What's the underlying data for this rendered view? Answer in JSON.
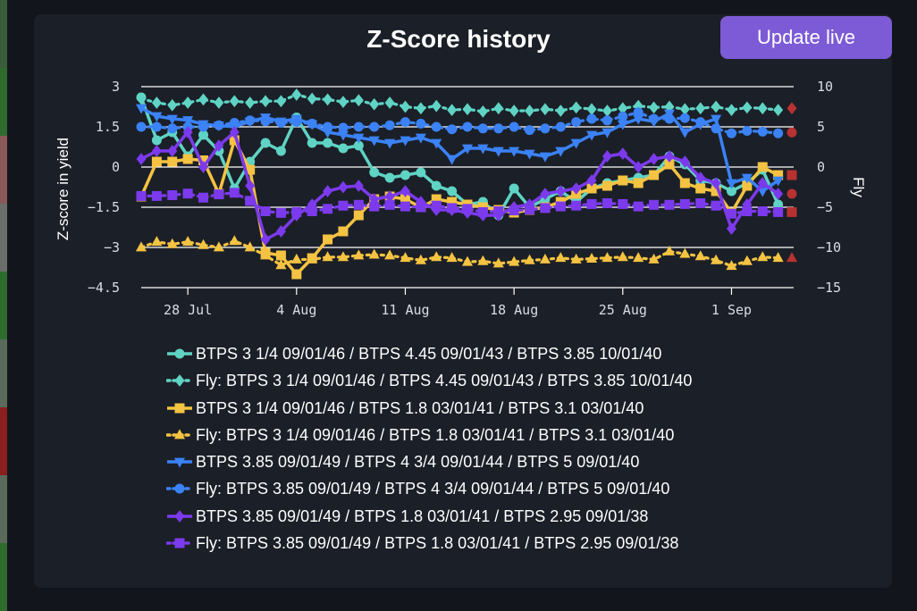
{
  "page": {
    "background": "#12151c",
    "panel_background": "#1b1f27",
    "strip_colors": [
      "#3a5c3a",
      "#2f6b2f",
      "#8a5858",
      "#6a6f6a",
      "#2e6b2e",
      "#5a6a5a",
      "#8a1f1f",
      "#5a6a5a",
      "#2e6b2e"
    ]
  },
  "header": {
    "title": "Z-Score history",
    "update_button": "Update live"
  },
  "chart_data": {
    "type": "line",
    "title": "Z-Score history",
    "ylabel": "Z-score in yield",
    "y2label": "Fly",
    "ylim": [
      -4.5,
      3
    ],
    "y2lim": [
      -15,
      10
    ],
    "yticks": [
      3,
      1.5,
      0,
      -1.5,
      -3,
      -4.5
    ],
    "yticklabels": [
      "3",
      "1.5",
      "0",
      "−1.5",
      "−3",
      "−4.5"
    ],
    "y2ticks": [
      10,
      5,
      0,
      -5,
      -10,
      -15
    ],
    "y2ticklabels": [
      "10",
      "5",
      "0",
      "−5",
      "−10",
      "−15"
    ],
    "x_range": [
      "2025-07-25",
      "2025-09-05"
    ],
    "xticks": [
      "2025-07-28",
      "2025-08-04",
      "2025-08-11",
      "2025-08-18",
      "2025-08-25",
      "2025-09-01"
    ],
    "xticklabels": [
      "28 Jul",
      "4 Aug",
      "11 Aug",
      "18 Aug",
      "25 Aug",
      "1 Sep"
    ],
    "grid": "horizontal",
    "legend_position": "bottom",
    "x": [
      "2025-07-25",
      "2025-07-26",
      "2025-07-27",
      "2025-07-28",
      "2025-07-29",
      "2025-07-30",
      "2025-07-31",
      "2025-08-01",
      "2025-08-02",
      "2025-08-03",
      "2025-08-04",
      "2025-08-05",
      "2025-08-06",
      "2025-08-07",
      "2025-08-08",
      "2025-08-09",
      "2025-08-10",
      "2025-08-11",
      "2025-08-12",
      "2025-08-13",
      "2025-08-14",
      "2025-08-15",
      "2025-08-16",
      "2025-08-17",
      "2025-08-18",
      "2025-08-19",
      "2025-08-20",
      "2025-08-21",
      "2025-08-22",
      "2025-08-23",
      "2025-08-24",
      "2025-08-25",
      "2025-08-26",
      "2025-08-27",
      "2025-08-28",
      "2025-08-29",
      "2025-08-30",
      "2025-08-31",
      "2025-09-01",
      "2025-09-02",
      "2025-09-03",
      "2025-09-04"
    ],
    "series": [
      {
        "name": "BTPS 3 1/4 09/01/46 / BTPS 4.45 09/01/43 / BTPS 3.85 10/01/40",
        "axis": "left",
        "color": "#5fd3c4",
        "marker": "circle",
        "dash": "solid",
        "values": [
          2.6,
          1,
          1.3,
          0.4,
          1.2,
          0.6,
          -0.8,
          0.2,
          0.9,
          0.6,
          1.85,
          0.9,
          0.9,
          0.7,
          0.8,
          -0.2,
          -0.4,
          -0.3,
          -0.2,
          -0.7,
          -0.9,
          -1.4,
          -1.3,
          -1.8,
          -0.8,
          -1.5,
          -1.2,
          -0.9,
          -1.3,
          -0.8,
          -0.6,
          -0.5,
          -0.4,
          -0.3,
          0.4,
          0.1,
          -0.5,
          -0.6,
          -0.9,
          -0.6,
          -0.1,
          -1.4
        ]
      },
      {
        "name": "Fly: BTPS 3 1/4 09/01/46 / BTPS 4.45 09/01/43 / BTPS 3.85 10/01/40",
        "axis": "right",
        "color": "#5fd3c4",
        "marker": "diamond",
        "dash": "dotted",
        "values": [
          8.5,
          8,
          7.7,
          8,
          8.4,
          8,
          8.2,
          8,
          8.2,
          8.2,
          9,
          8.5,
          8.4,
          8.1,
          8.3,
          7.8,
          8,
          7.5,
          7.3,
          7.6,
          7.1,
          7.2,
          6.9,
          7.3,
          7,
          7,
          7.2,
          7,
          7.4,
          7.2,
          7,
          7.3,
          7.6,
          7.4,
          7.5,
          7.2,
          7.3,
          7.5,
          7.1,
          7.4,
          7.3,
          7.1
        ]
      },
      {
        "name": "BTPS 3 1/4 09/01/46 / BTPS 1.8 03/01/41 / BTPS 3.1 03/01/40",
        "axis": "left",
        "color": "#f5c342",
        "marker": "square",
        "dash": "solid",
        "values": [
          -1.1,
          0.2,
          0.2,
          0.3,
          0.25,
          -1,
          1.0,
          -0.1,
          -3.2,
          -3.3,
          -4.0,
          -3.4,
          -2.7,
          -2.4,
          -1.8,
          -1.2,
          -1.1,
          -1.2,
          -1.5,
          -1.2,
          -1.3,
          -1.4,
          -1.5,
          -1.6,
          -1.7,
          -1.6,
          -1.5,
          -1.3,
          -1.0,
          -0.8,
          -0.7,
          -0.5,
          -0.6,
          -0.3,
          0.1,
          -0.6,
          -0.8,
          -0.9,
          -1.7,
          -0.7,
          0.0,
          -0.3
        ]
      },
      {
        "name": "Fly: BTPS 3 1/4 09/01/46 / BTPS 1.8 03/01/41 / BTPS 3.1 03/01/40",
        "axis": "right",
        "color": "#f5c342",
        "marker": "triangle",
        "dash": "dotted",
        "values": [
          -10,
          -9.3,
          -9.6,
          -9.3,
          -9.7,
          -10,
          -9.2,
          -10,
          -11,
          -12.2,
          -11.5,
          -11.5,
          -11.2,
          -11.2,
          -11,
          -10.9,
          -11,
          -11.3,
          -11.6,
          -11.2,
          -11.3,
          -11.8,
          -11.7,
          -12,
          -11.8,
          -11.6,
          -11.5,
          -11.3,
          -11.5,
          -11.4,
          -11.3,
          -11.2,
          -11.3,
          -11.5,
          -10.5,
          -10.8,
          -11.1,
          -11.6,
          -12.3,
          -11.7,
          -11.2,
          -11.3
        ]
      },
      {
        "name": "BTPS 3.85 09/01/49 / BTPS 4 3/4 09/01/44 / BTPS 5 09/01/40",
        "axis": "left",
        "color": "#3b82f6",
        "marker": "triangle-down",
        "dash": "solid",
        "values": [
          2.2,
          1.9,
          1.8,
          1.75,
          1.6,
          1.55,
          1.5,
          1.7,
          1.85,
          1.7,
          1.8,
          1.6,
          1.3,
          1.2,
          1.1,
          1.0,
          0.9,
          1.0,
          1.1,
          0.9,
          0.3,
          0.7,
          0.7,
          0.6,
          0.6,
          0.5,
          0.4,
          0.6,
          0.9,
          1.2,
          1.3,
          1.6,
          1.8,
          1.7,
          2.0,
          1.3,
          1.6,
          1.8,
          -0.6,
          -0.4,
          -0.9,
          -0.5
        ]
      },
      {
        "name": "Fly: BTPS 3.85 09/01/49 / BTPS 4 3/4 09/01/44 / BTPS 5 09/01/40",
        "axis": "right",
        "color": "#3b82f6",
        "marker": "circle",
        "dash": "dotted",
        "values": [
          5,
          5,
          4.8,
          5,
          5,
          5.2,
          5.5,
          5.8,
          5.7,
          5.5,
          5.6,
          5.4,
          5,
          4.9,
          5,
          5,
          5.2,
          5.6,
          5.4,
          5,
          4.7,
          5,
          4.8,
          4.8,
          5,
          4.6,
          4.8,
          5,
          5.6,
          6,
          5.8,
          6.3,
          6.8,
          6,
          6,
          6.1,
          5.6,
          4.8,
          4.2,
          4.5,
          4.4,
          4.2
        ]
      },
      {
        "name": "BTPS 3.85 09/01/49 / BTPS 1.8 03/01/41 / BTPS 2.95 09/01/38",
        "axis": "left",
        "color": "#7c3aed",
        "marker": "diamond",
        "dash": "solid",
        "values": [
          0.3,
          0.6,
          0.6,
          1.3,
          0,
          0.8,
          1.3,
          -0.7,
          -2.7,
          -2.4,
          -1.8,
          -1.4,
          -0.9,
          -0.75,
          -0.7,
          -1.2,
          -1.1,
          -0.9,
          -1.3,
          -1.6,
          -1.6,
          -1.7,
          -1.8,
          -1.8,
          -1.5,
          -1.4,
          -1.0,
          -0.9,
          -0.8,
          -0.5,
          0.4,
          0.5,
          0.0,
          0.3,
          0.4,
          0.2,
          -0.4,
          -0.6,
          -2.3,
          -1.4,
          -0.6,
          -1.0
        ]
      },
      {
        "name": "Fly: BTPS 3.85 09/01/49 / BTPS 1.8 03/01/41 / BTPS 2.95 09/01/38",
        "axis": "right",
        "color": "#7c3aed",
        "marker": "square",
        "dash": "dotted",
        "values": [
          -3.6,
          -3.6,
          -3.5,
          -3.3,
          -3.8,
          -3.4,
          -3.2,
          -4.2,
          -5.5,
          -5.7,
          -5.6,
          -5.5,
          -5.2,
          -4.8,
          -4.7,
          -4.9,
          -4.7,
          -4.9,
          -5,
          -4.8,
          -5.1,
          -5.2,
          -5.6,
          -5.5,
          -5.4,
          -5.3,
          -5.1,
          -4.9,
          -4.8,
          -4.6,
          -4.5,
          -4.6,
          -4.9,
          -4.7,
          -4.7,
          -4.6,
          -4.5,
          -4.8,
          -5.8,
          -5.5,
          -5.5,
          -5.6
        ]
      }
    ],
    "end_markers": [
      {
        "axis": "right",
        "value": 7.3,
        "color": "#b83232",
        "shape": "diamond"
      },
      {
        "axis": "right",
        "value": 4.3,
        "color": "#b83232",
        "shape": "circle"
      },
      {
        "axis": "left",
        "value": -0.3,
        "color": "#b83232",
        "shape": "square"
      },
      {
        "axis": "left",
        "value": -1.0,
        "color": "#b83232",
        "shape": "circle"
      },
      {
        "axis": "right",
        "value": -5.6,
        "color": "#b83232",
        "shape": "square"
      },
      {
        "axis": "right",
        "value": -11.3,
        "color": "#b83232",
        "shape": "triangle"
      }
    ]
  }
}
